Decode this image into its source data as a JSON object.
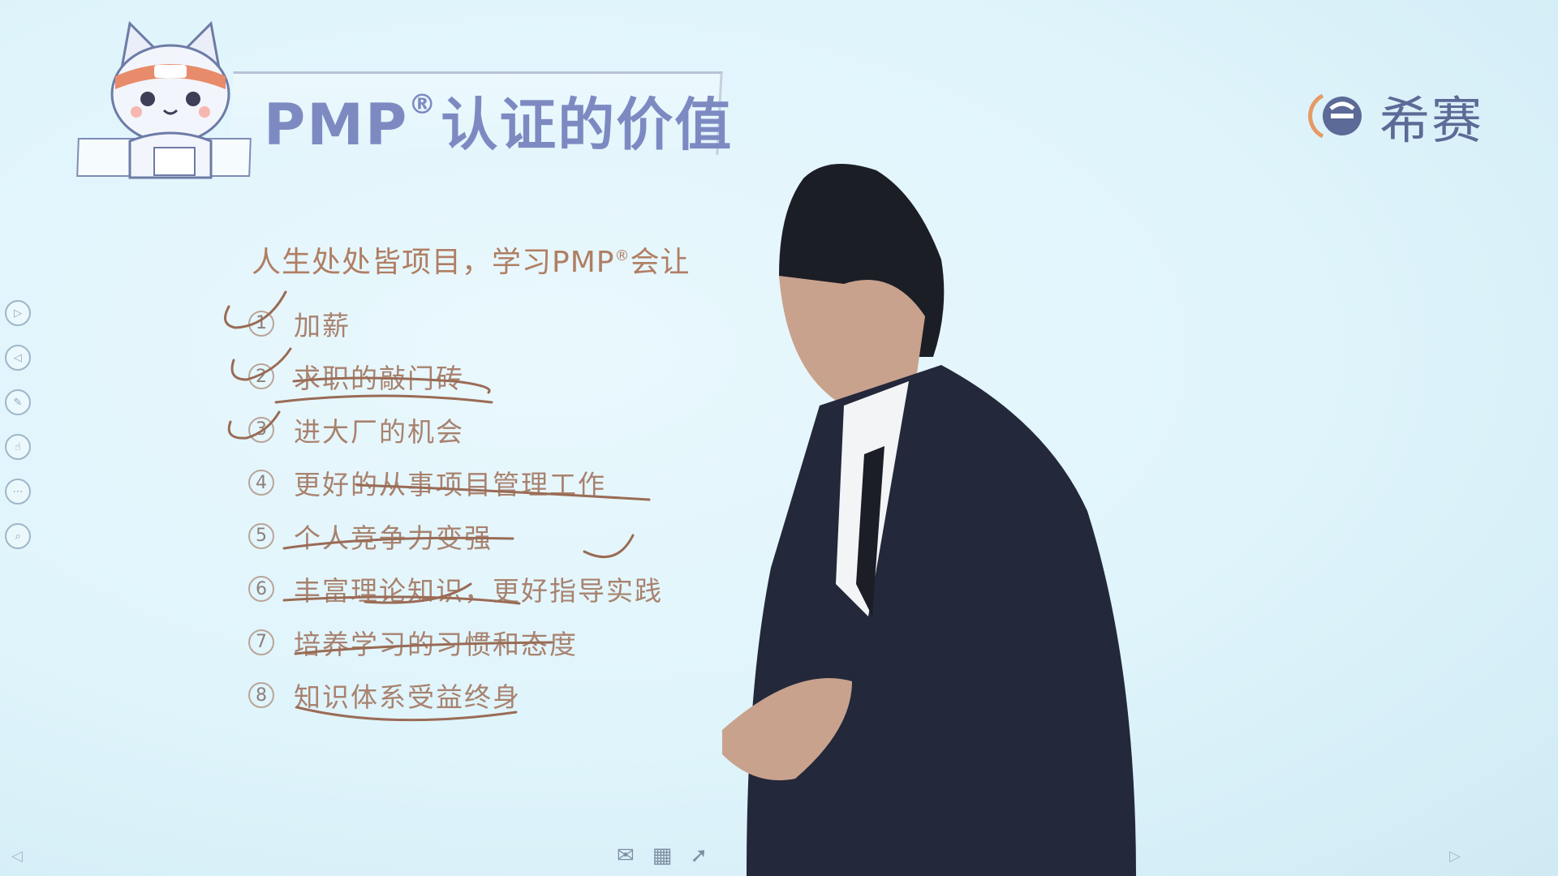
{
  "slide": {
    "title": "PMP",
    "title_reg": "®",
    "title_rest": "认证的价值",
    "brand": "希赛",
    "subtitle_main": "人生处处皆项目，学习PMP",
    "subtitle_reg": "®",
    "subtitle_tail": "会让",
    "items": [
      {
        "num": "1",
        "text": "加薪"
      },
      {
        "num": "2",
        "text": "求职的敲门砖"
      },
      {
        "num": "3",
        "text": "进大厂的机会"
      },
      {
        "num": "4",
        "text": "更好的从事项目管理工作"
      },
      {
        "num": "5",
        "text": "个人竞争力变强"
      },
      {
        "num": "6",
        "text": "丰富理论知识，更好指导实践"
      },
      {
        "num": "7",
        "text": "培养学习的习惯和态度"
      },
      {
        "num": "8",
        "text": "知识体系受益终身"
      }
    ]
  },
  "toolbar": {
    "left_tools": [
      "play-icon",
      "back-icon",
      "pen-icon",
      "pointer-icon",
      "more-icon",
      "zoom-icon"
    ],
    "bottom_tools": [
      "mail-icon",
      "grid-icon",
      "cursor-icon"
    ]
  },
  "colors": {
    "title": "#7d8ac2",
    "text": "#a8826f",
    "ink": "#9a6b55",
    "suit": "#23283a"
  }
}
